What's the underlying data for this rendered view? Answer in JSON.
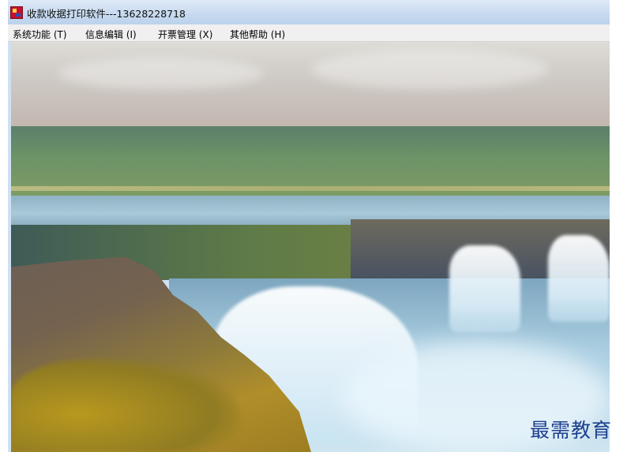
{
  "window": {
    "title": "收款收据打印软件---13628228718"
  },
  "menubar": {
    "items": [
      {
        "label": "系统功能 (T)"
      },
      {
        "label": "信息编辑 (I)"
      },
      {
        "label": "开票管理 (X)"
      },
      {
        "label": "其他帮助 (H)"
      }
    ]
  },
  "content": {
    "background_image": "waterfall-landscape"
  },
  "watermark": {
    "text": "最需教育"
  },
  "colors": {
    "titlebar": "#c6d9ef",
    "menubar": "#f0f0f0",
    "watermark": "#1d3f8f"
  }
}
